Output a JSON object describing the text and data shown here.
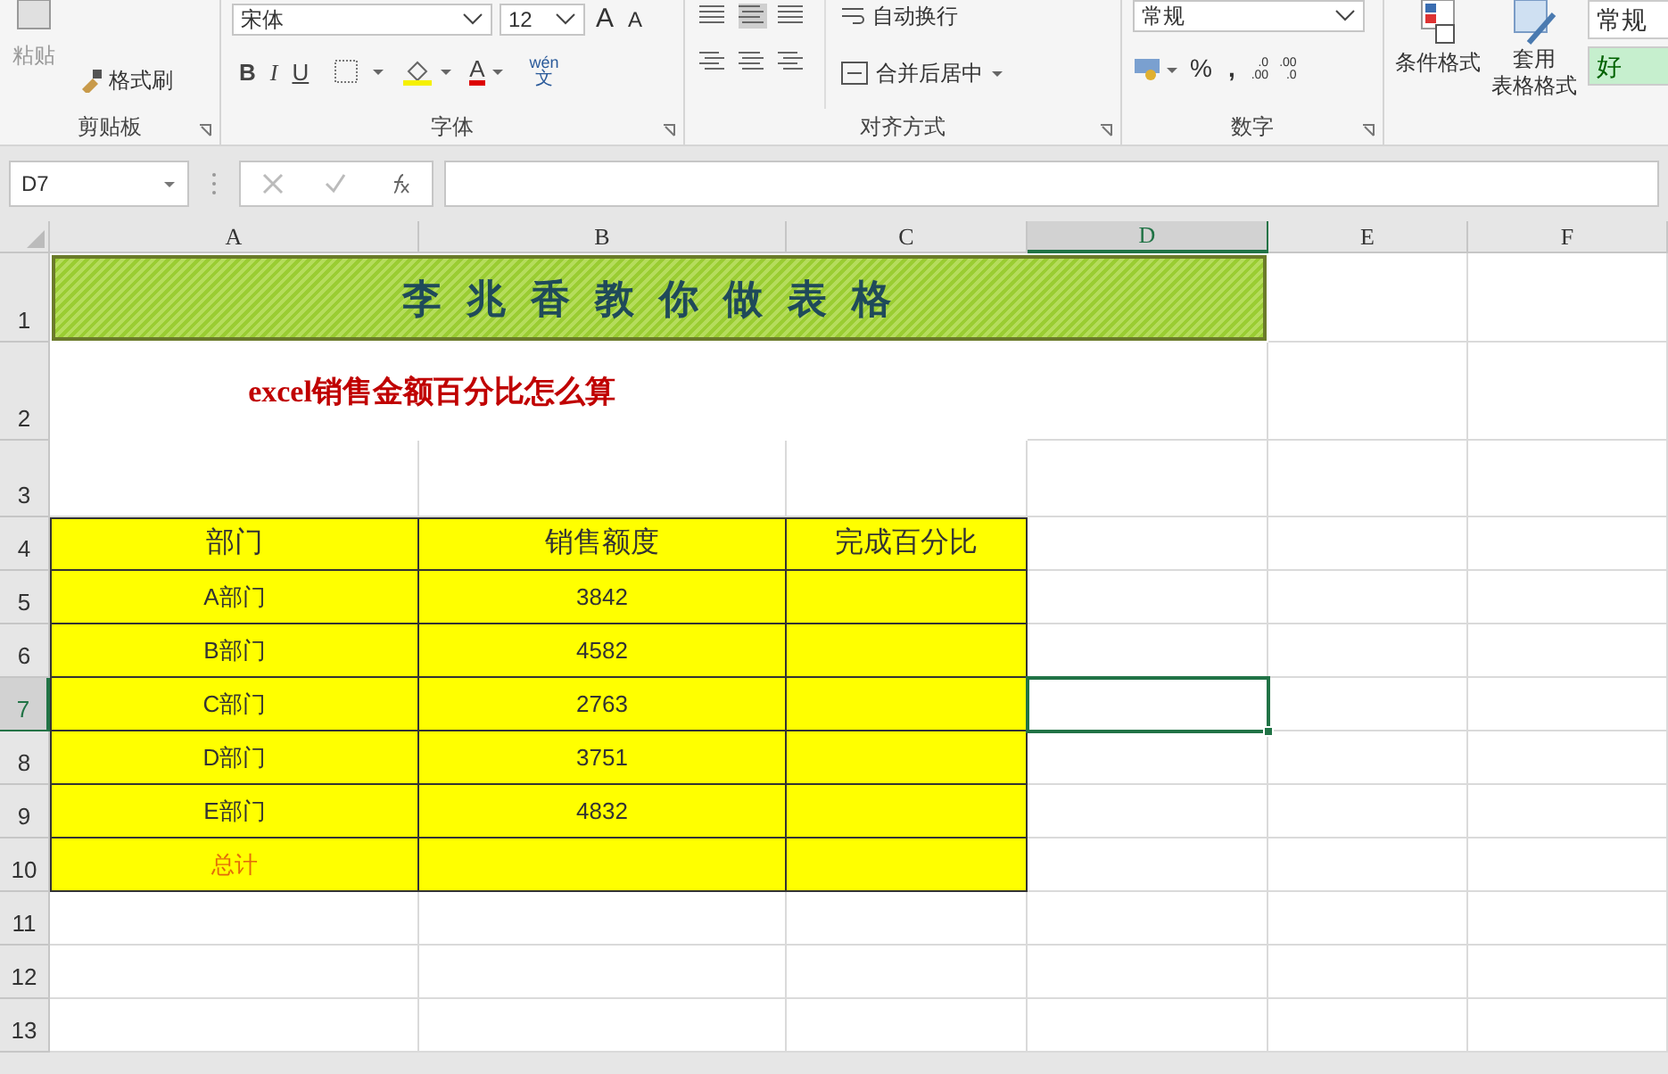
{
  "ribbon": {
    "clipboard": {
      "paste": "粘贴",
      "format_painter": "格式刷",
      "label": "剪贴板"
    },
    "font": {
      "font_name": "宋体",
      "font_size": "12",
      "grow": "A",
      "shrink": "A",
      "bold": "B",
      "italic": "I",
      "underline": "U",
      "font_color": "A",
      "phonetic_top": "wén",
      "phonetic_bottom": "文",
      "label": "字体"
    },
    "alignment": {
      "wrap_text": "自动换行",
      "merge_center": "合并后居中",
      "label": "对齐方式"
    },
    "number": {
      "format": "常规",
      "percent": "%",
      "comma": ",",
      "increase_decimal": [
        ".0",
        ".00"
      ],
      "decrease_decimal": [
        ".00",
        ".0"
      ],
      "label": "数字"
    },
    "styles": {
      "conditional_format": "条件格式",
      "table_format": [
        "套用",
        "表格格式"
      ],
      "style_normal": "常规",
      "style_good": "好"
    }
  },
  "formula_bar": {
    "name_box": "D7"
  },
  "sheet": {
    "columns": [
      {
        "label": "A",
        "selected": false
      },
      {
        "label": "B",
        "selected": false
      },
      {
        "label": "C",
        "selected": false
      },
      {
        "label": "D",
        "selected": true
      },
      {
        "label": "E",
        "selected": false
      },
      {
        "label": "F",
        "selected": false
      }
    ],
    "rows": [
      {
        "label": "1",
        "selected": false
      },
      {
        "label": "2",
        "selected": false
      },
      {
        "label": "3",
        "selected": false
      },
      {
        "label": "4",
        "selected": false
      },
      {
        "label": "5",
        "selected": false
      },
      {
        "label": "6",
        "selected": false
      },
      {
        "label": "7",
        "selected": true
      },
      {
        "label": "8",
        "selected": false
      },
      {
        "label": "9",
        "selected": false
      },
      {
        "label": "10",
        "selected": false
      },
      {
        "label": "11",
        "selected": false
      },
      {
        "label": "12",
        "selected": false
      },
      {
        "label": "13",
        "selected": false
      }
    ],
    "title": "李兆香教你做表格",
    "subtitle": "excel销售金额百分比怎么算",
    "table": {
      "headers": [
        "部门",
        "销售额度",
        "完成百分比"
      ],
      "rows": [
        {
          "department": "A部门",
          "amount": "3842"
        },
        {
          "department": "B部门",
          "amount": "4582"
        },
        {
          "department": "C部门",
          "amount": "2763"
        },
        {
          "department": "D部门",
          "amount": "3751"
        },
        {
          "department": "E部门",
          "amount": "4832"
        }
      ],
      "total_label": "总计"
    }
  }
}
